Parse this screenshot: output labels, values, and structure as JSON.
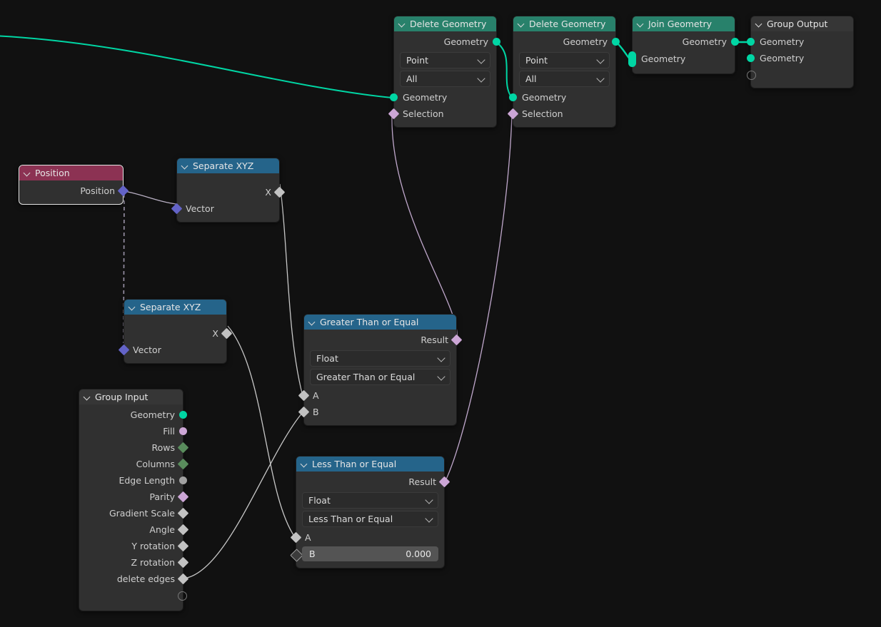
{
  "editor": {
    "name": "Blender Geometry Node Editor",
    "background": "#111111"
  },
  "colors": {
    "header_geometry": "#28816b",
    "header_converter": "#25648a",
    "header_input": "#8c3253",
    "header_group": "#363636",
    "node_body": "#303030",
    "socket_geometry": "#00d6a4",
    "socket_boolean": "#cca6d6",
    "socket_integer": "#598c5c",
    "socket_float": "#a1a1a1",
    "socket_vector": "#6363c7",
    "link_geometry": "#00d6a4",
    "link_boolean": "#cca6d6",
    "link_float": "#c8c8c8"
  },
  "nodes": {
    "delete_geometry_1": {
      "title": "Delete Geometry",
      "outputs": [
        {
          "label": "Geometry",
          "type": "geometry"
        }
      ],
      "dropdowns": [
        {
          "name": "domain",
          "value": "Point"
        },
        {
          "name": "mode",
          "value": "All"
        }
      ],
      "inputs": [
        {
          "label": "Geometry",
          "type": "geometry"
        },
        {
          "label": "Selection",
          "type": "boolean"
        }
      ]
    },
    "delete_geometry_2": {
      "title": "Delete Geometry",
      "outputs": [
        {
          "label": "Geometry",
          "type": "geometry"
        }
      ],
      "dropdowns": [
        {
          "name": "domain",
          "value": "Point"
        },
        {
          "name": "mode",
          "value": "All"
        }
      ],
      "inputs": [
        {
          "label": "Geometry",
          "type": "geometry"
        },
        {
          "label": "Selection",
          "type": "boolean"
        }
      ]
    },
    "join_geometry": {
      "title": "Join Geometry",
      "outputs": [
        {
          "label": "Geometry",
          "type": "geometry"
        }
      ],
      "inputs": [
        {
          "label": "Geometry",
          "type": "geometry-multi"
        }
      ]
    },
    "group_output": {
      "title": "Group Output",
      "inputs": [
        {
          "label": "Geometry",
          "type": "geometry"
        },
        {
          "label": "Geometry",
          "type": "geometry"
        },
        {
          "label": "",
          "type": "empty"
        }
      ]
    },
    "position": {
      "title": "Position",
      "selected": true,
      "outputs": [
        {
          "label": "Position",
          "type": "vector"
        }
      ]
    },
    "separate_xyz_1": {
      "title": "Separate XYZ",
      "outputs": [
        {
          "label": "X",
          "type": "float-linked"
        }
      ],
      "inputs": [
        {
          "label": "Vector",
          "type": "vector"
        }
      ]
    },
    "separate_xyz_2": {
      "title": "Separate XYZ",
      "outputs": [
        {
          "label": "X",
          "type": "float-linked"
        }
      ],
      "inputs": [
        {
          "label": "Vector",
          "type": "vector"
        }
      ]
    },
    "greater_than_or_equal": {
      "title": "Greater Than or Equal",
      "outputs": [
        {
          "label": "Result",
          "type": "boolean"
        }
      ],
      "dropdowns": [
        {
          "name": "data_type",
          "value": "Float"
        },
        {
          "name": "operation",
          "value": "Greater Than or Equal"
        }
      ],
      "inputs": [
        {
          "label": "A",
          "type": "float-linked"
        },
        {
          "label": "B",
          "type": "float-linked"
        }
      ]
    },
    "less_than_or_equal": {
      "title": "Less Than or Equal",
      "outputs": [
        {
          "label": "Result",
          "type": "boolean"
        }
      ],
      "dropdowns": [
        {
          "name": "data_type",
          "value": "Float"
        },
        {
          "name": "operation",
          "value": "Less Than or Equal"
        }
      ],
      "inputs": [
        {
          "label": "A",
          "type": "float-linked"
        },
        {
          "label": "B",
          "type": "float-unlinked",
          "value": "0.000"
        }
      ]
    },
    "group_input": {
      "title": "Group Input",
      "outputs": [
        {
          "label": "Geometry",
          "type": "geometry"
        },
        {
          "label": "Fill",
          "type": "boolean"
        },
        {
          "label": "Rows",
          "type": "integer"
        },
        {
          "label": "Columns",
          "type": "integer"
        },
        {
          "label": "Edge Length",
          "type": "float"
        },
        {
          "label": "Parity",
          "type": "boolean"
        },
        {
          "label": "Gradient Scale",
          "type": "float-linked"
        },
        {
          "label": "Angle",
          "type": "float-linked"
        },
        {
          "label": "Y rotation",
          "type": "float-linked"
        },
        {
          "label": "Z rotation",
          "type": "float-linked"
        },
        {
          "label": "delete edges",
          "type": "float-linked"
        },
        {
          "label": "",
          "type": "empty"
        }
      ]
    }
  }
}
